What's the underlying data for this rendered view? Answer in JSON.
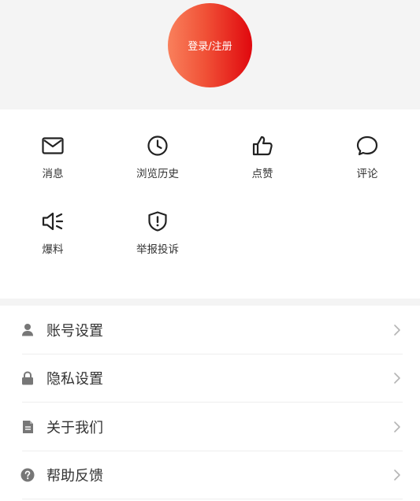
{
  "header": {
    "login_label": "登录/注册"
  },
  "quick_actions": [
    {
      "label": "消息",
      "icon": "mail-icon"
    },
    {
      "label": "浏览历史",
      "icon": "clock-icon"
    },
    {
      "label": "点赞",
      "icon": "thumbs-up-icon"
    },
    {
      "label": "评论",
      "icon": "comment-icon"
    },
    {
      "label": "爆料",
      "icon": "megaphone-icon"
    },
    {
      "label": "举报投诉",
      "icon": "shield-alert-icon"
    }
  ],
  "menu": [
    {
      "label": "账号设置",
      "icon": "user-icon"
    },
    {
      "label": "隐私设置",
      "icon": "lock-icon"
    },
    {
      "label": "关于我们",
      "icon": "document-icon"
    },
    {
      "label": "帮助反馈",
      "icon": "help-icon"
    }
  ],
  "colors": {
    "accent_start": "#f9805c",
    "accent_end": "#e0080e",
    "background_gray": "#f4f4f4",
    "icon_gray": "#777777"
  }
}
